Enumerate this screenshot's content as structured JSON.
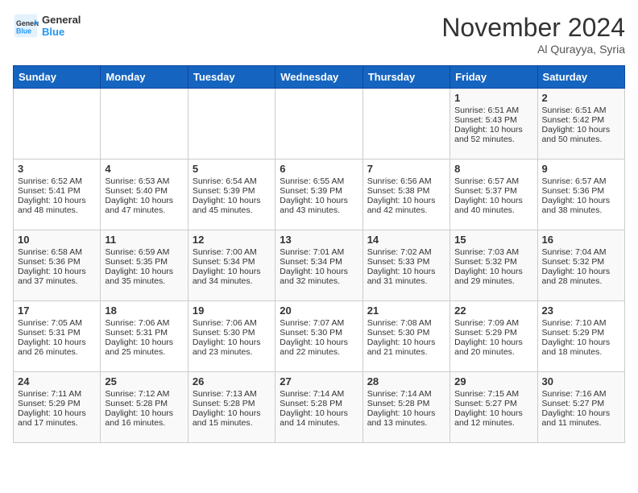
{
  "header": {
    "logo_line1": "General",
    "logo_line2": "Blue",
    "month": "November 2024",
    "location": "Al Qurayya, Syria"
  },
  "weekdays": [
    "Sunday",
    "Monday",
    "Tuesday",
    "Wednesday",
    "Thursday",
    "Friday",
    "Saturday"
  ],
  "weeks": [
    [
      {
        "day": "",
        "content": ""
      },
      {
        "day": "",
        "content": ""
      },
      {
        "day": "",
        "content": ""
      },
      {
        "day": "",
        "content": ""
      },
      {
        "day": "",
        "content": ""
      },
      {
        "day": "1",
        "content": "Sunrise: 6:51 AM\nSunset: 5:43 PM\nDaylight: 10 hours and 52 minutes."
      },
      {
        "day": "2",
        "content": "Sunrise: 6:51 AM\nSunset: 5:42 PM\nDaylight: 10 hours and 50 minutes."
      }
    ],
    [
      {
        "day": "3",
        "content": "Sunrise: 6:52 AM\nSunset: 5:41 PM\nDaylight: 10 hours and 48 minutes."
      },
      {
        "day": "4",
        "content": "Sunrise: 6:53 AM\nSunset: 5:40 PM\nDaylight: 10 hours and 47 minutes."
      },
      {
        "day": "5",
        "content": "Sunrise: 6:54 AM\nSunset: 5:39 PM\nDaylight: 10 hours and 45 minutes."
      },
      {
        "day": "6",
        "content": "Sunrise: 6:55 AM\nSunset: 5:39 PM\nDaylight: 10 hours and 43 minutes."
      },
      {
        "day": "7",
        "content": "Sunrise: 6:56 AM\nSunset: 5:38 PM\nDaylight: 10 hours and 42 minutes."
      },
      {
        "day": "8",
        "content": "Sunrise: 6:57 AM\nSunset: 5:37 PM\nDaylight: 10 hours and 40 minutes."
      },
      {
        "day": "9",
        "content": "Sunrise: 6:57 AM\nSunset: 5:36 PM\nDaylight: 10 hours and 38 minutes."
      }
    ],
    [
      {
        "day": "10",
        "content": "Sunrise: 6:58 AM\nSunset: 5:36 PM\nDaylight: 10 hours and 37 minutes."
      },
      {
        "day": "11",
        "content": "Sunrise: 6:59 AM\nSunset: 5:35 PM\nDaylight: 10 hours and 35 minutes."
      },
      {
        "day": "12",
        "content": "Sunrise: 7:00 AM\nSunset: 5:34 PM\nDaylight: 10 hours and 34 minutes."
      },
      {
        "day": "13",
        "content": "Sunrise: 7:01 AM\nSunset: 5:34 PM\nDaylight: 10 hours and 32 minutes."
      },
      {
        "day": "14",
        "content": "Sunrise: 7:02 AM\nSunset: 5:33 PM\nDaylight: 10 hours and 31 minutes."
      },
      {
        "day": "15",
        "content": "Sunrise: 7:03 AM\nSunset: 5:32 PM\nDaylight: 10 hours and 29 minutes."
      },
      {
        "day": "16",
        "content": "Sunrise: 7:04 AM\nSunset: 5:32 PM\nDaylight: 10 hours and 28 minutes."
      }
    ],
    [
      {
        "day": "17",
        "content": "Sunrise: 7:05 AM\nSunset: 5:31 PM\nDaylight: 10 hours and 26 minutes."
      },
      {
        "day": "18",
        "content": "Sunrise: 7:06 AM\nSunset: 5:31 PM\nDaylight: 10 hours and 25 minutes."
      },
      {
        "day": "19",
        "content": "Sunrise: 7:06 AM\nSunset: 5:30 PM\nDaylight: 10 hours and 23 minutes."
      },
      {
        "day": "20",
        "content": "Sunrise: 7:07 AM\nSunset: 5:30 PM\nDaylight: 10 hours and 22 minutes."
      },
      {
        "day": "21",
        "content": "Sunrise: 7:08 AM\nSunset: 5:30 PM\nDaylight: 10 hours and 21 minutes."
      },
      {
        "day": "22",
        "content": "Sunrise: 7:09 AM\nSunset: 5:29 PM\nDaylight: 10 hours and 20 minutes."
      },
      {
        "day": "23",
        "content": "Sunrise: 7:10 AM\nSunset: 5:29 PM\nDaylight: 10 hours and 18 minutes."
      }
    ],
    [
      {
        "day": "24",
        "content": "Sunrise: 7:11 AM\nSunset: 5:29 PM\nDaylight: 10 hours and 17 minutes."
      },
      {
        "day": "25",
        "content": "Sunrise: 7:12 AM\nSunset: 5:28 PM\nDaylight: 10 hours and 16 minutes."
      },
      {
        "day": "26",
        "content": "Sunrise: 7:13 AM\nSunset: 5:28 PM\nDaylight: 10 hours and 15 minutes."
      },
      {
        "day": "27",
        "content": "Sunrise: 7:14 AM\nSunset: 5:28 PM\nDaylight: 10 hours and 14 minutes."
      },
      {
        "day": "28",
        "content": "Sunrise: 7:14 AM\nSunset: 5:28 PM\nDaylight: 10 hours and 13 minutes."
      },
      {
        "day": "29",
        "content": "Sunrise: 7:15 AM\nSunset: 5:27 PM\nDaylight: 10 hours and 12 minutes."
      },
      {
        "day": "30",
        "content": "Sunrise: 7:16 AM\nSunset: 5:27 PM\nDaylight: 10 hours and 11 minutes."
      }
    ]
  ]
}
